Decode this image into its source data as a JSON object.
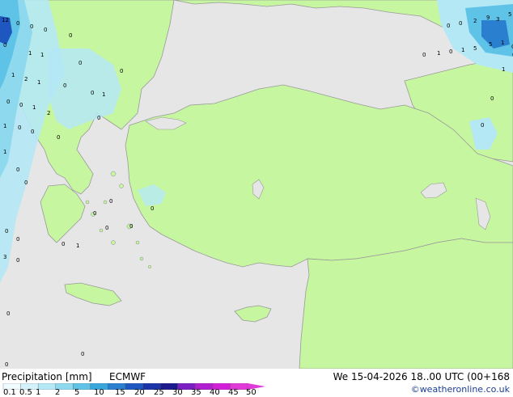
{
  "footer": {
    "title": "Precipitation [mm]",
    "model": "ECMWF",
    "valid_time": "We 15-04-2026 18..00 UTC (00+168",
    "copyright": "©weatheronline.co.uk"
  },
  "legend": {
    "labels": [
      "0.1",
      "0.5",
      "1",
      "2",
      "5",
      "10",
      "15",
      "20",
      "25",
      "30",
      "35",
      "40",
      "45",
      "50"
    ],
    "colors": [
      "#f0fbff",
      "#d4f2fb",
      "#b4e8f5",
      "#8ed9ee",
      "#5ec3e6",
      "#39a6dc",
      "#2a7fcf",
      "#1e57bf",
      "#1b35a8",
      "#1c1a8c",
      "#7a1fc2",
      "#b01fd0",
      "#d21fd8",
      "#e03ad8"
    ]
  },
  "map": {
    "colors": {
      "land": "#c6f7a0",
      "sea": "#e6e6e6",
      "border": "#888888"
    },
    "point_values": [
      "12",
      "0",
      "0",
      "0",
      "0",
      "0",
      "1",
      "1",
      "0",
      "0",
      "1",
      "2",
      "1",
      "0",
      "0",
      "1",
      "0",
      "0",
      "1",
      "2",
      "0",
      "1",
      "0",
      "0",
      "0",
      "1",
      "0",
      "0",
      "0",
      "0",
      "0",
      "0",
      "0",
      "1",
      "3",
      "0",
      "0",
      "0",
      "0",
      "0",
      "0",
      "0",
      "0",
      "0",
      "2",
      "9",
      "3",
      "5",
      "0",
      "1",
      "0",
      "1",
      "5",
      "5",
      "1",
      "0",
      "0",
      "1",
      "0",
      "0"
    ]
  }
}
